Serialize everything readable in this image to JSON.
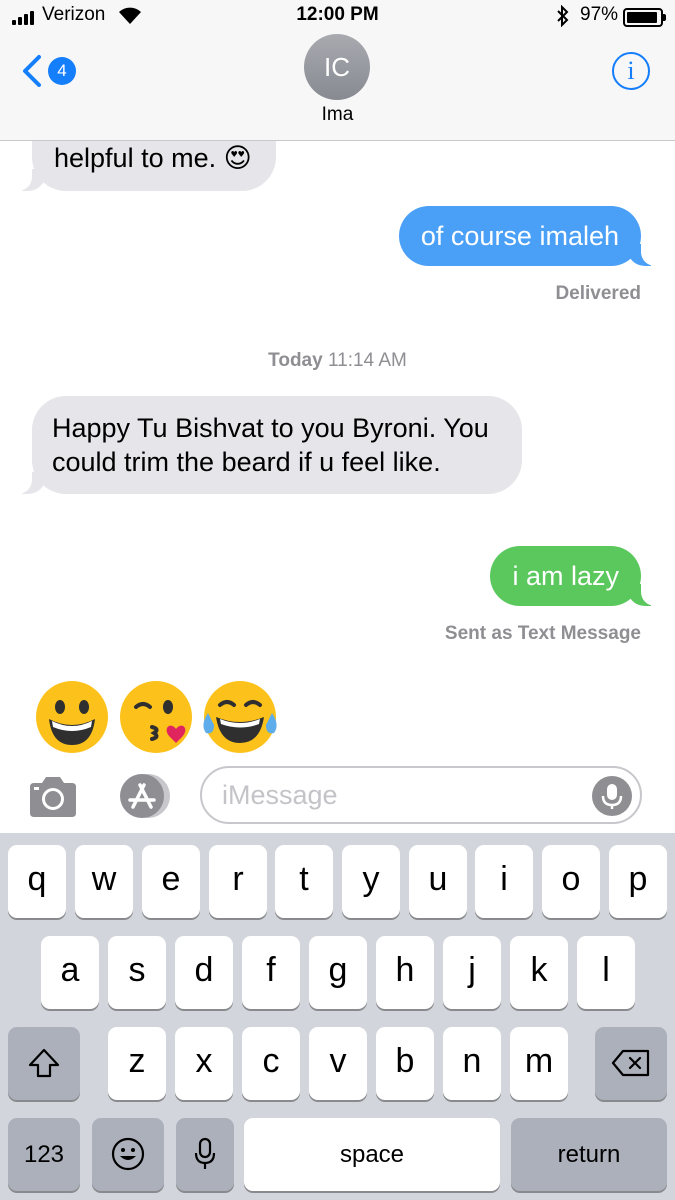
{
  "status_bar": {
    "carrier": "Verizon",
    "time": "12:00 PM",
    "battery": "97%"
  },
  "nav": {
    "back_badge": "4",
    "avatar_initials": "IC",
    "contact_name": "Ima"
  },
  "messages": {
    "m1": {
      "text": "helpful to me. 😍"
    },
    "m2": {
      "text": "of course imaleh",
      "status": "Delivered"
    },
    "timestamp": {
      "day": "Today",
      "time": "11:14 AM"
    },
    "m3": {
      "text": "Happy Tu Bishvat to you Byroni. You could trim the beard if u feel like."
    },
    "m4": {
      "text": "i am lazy",
      "status": "Sent as Text Message"
    },
    "m5": {
      "text": "😀😘😂"
    }
  },
  "input": {
    "placeholder": "iMessage"
  },
  "keyboard": {
    "row1": [
      "q",
      "w",
      "e",
      "r",
      "t",
      "y",
      "u",
      "i",
      "o",
      "p"
    ],
    "row2": [
      "a",
      "s",
      "d",
      "f",
      "g",
      "h",
      "j",
      "k",
      "l"
    ],
    "row3": [
      "z",
      "x",
      "c",
      "v",
      "b",
      "n",
      "m"
    ],
    "numbers": "123",
    "space": "space",
    "return": "return"
  },
  "colors": {
    "imessage_blue": "#4a9ff7",
    "sms_green": "#5bc85e",
    "incoming_gray": "#e5e5ea",
    "ios_blue": "#147efb"
  }
}
